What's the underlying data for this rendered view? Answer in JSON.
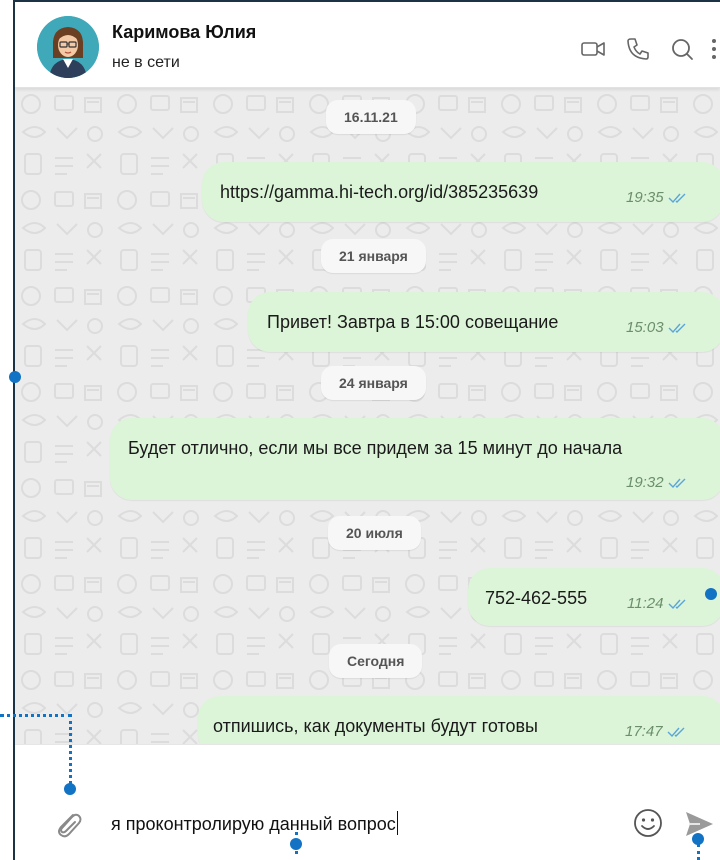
{
  "header": {
    "contact_name": "Каримова Юлия",
    "status": "не в сети",
    "icons": [
      "video-call-icon",
      "phone-icon",
      "search-icon",
      "more-icon"
    ]
  },
  "messages": [
    {
      "type": "date",
      "label": "16.11.21"
    },
    {
      "type": "out",
      "text": "https://gamma.hi-tech.org/id/385235639",
      "time": "19:35",
      "is_link": true
    },
    {
      "type": "date",
      "label": "21 января"
    },
    {
      "type": "out",
      "text": "Привет! Завтра в 15:00 совещание",
      "time": "15:03"
    },
    {
      "type": "date",
      "label": "24 января"
    },
    {
      "type": "out",
      "text": "Будет отлично, если мы все придем за 15 минут до начала",
      "time": "19:32"
    },
    {
      "type": "date",
      "label": "20 июля"
    },
    {
      "type": "out",
      "text": "752-462-555",
      "time": "11:24"
    },
    {
      "type": "date",
      "label": "Сегодня"
    },
    {
      "type": "out",
      "text": "отпишись, как документы будут готовы",
      "time": "17:47"
    }
  ],
  "composer": {
    "value": "я проконтролирую данный вопрос",
    "icons": [
      "attach-icon",
      "emoji-icon",
      "send-icon"
    ]
  },
  "colors": {
    "bubble": "#dcf5d8",
    "marker": "#1273c4",
    "frame_border": "#1c3346"
  }
}
